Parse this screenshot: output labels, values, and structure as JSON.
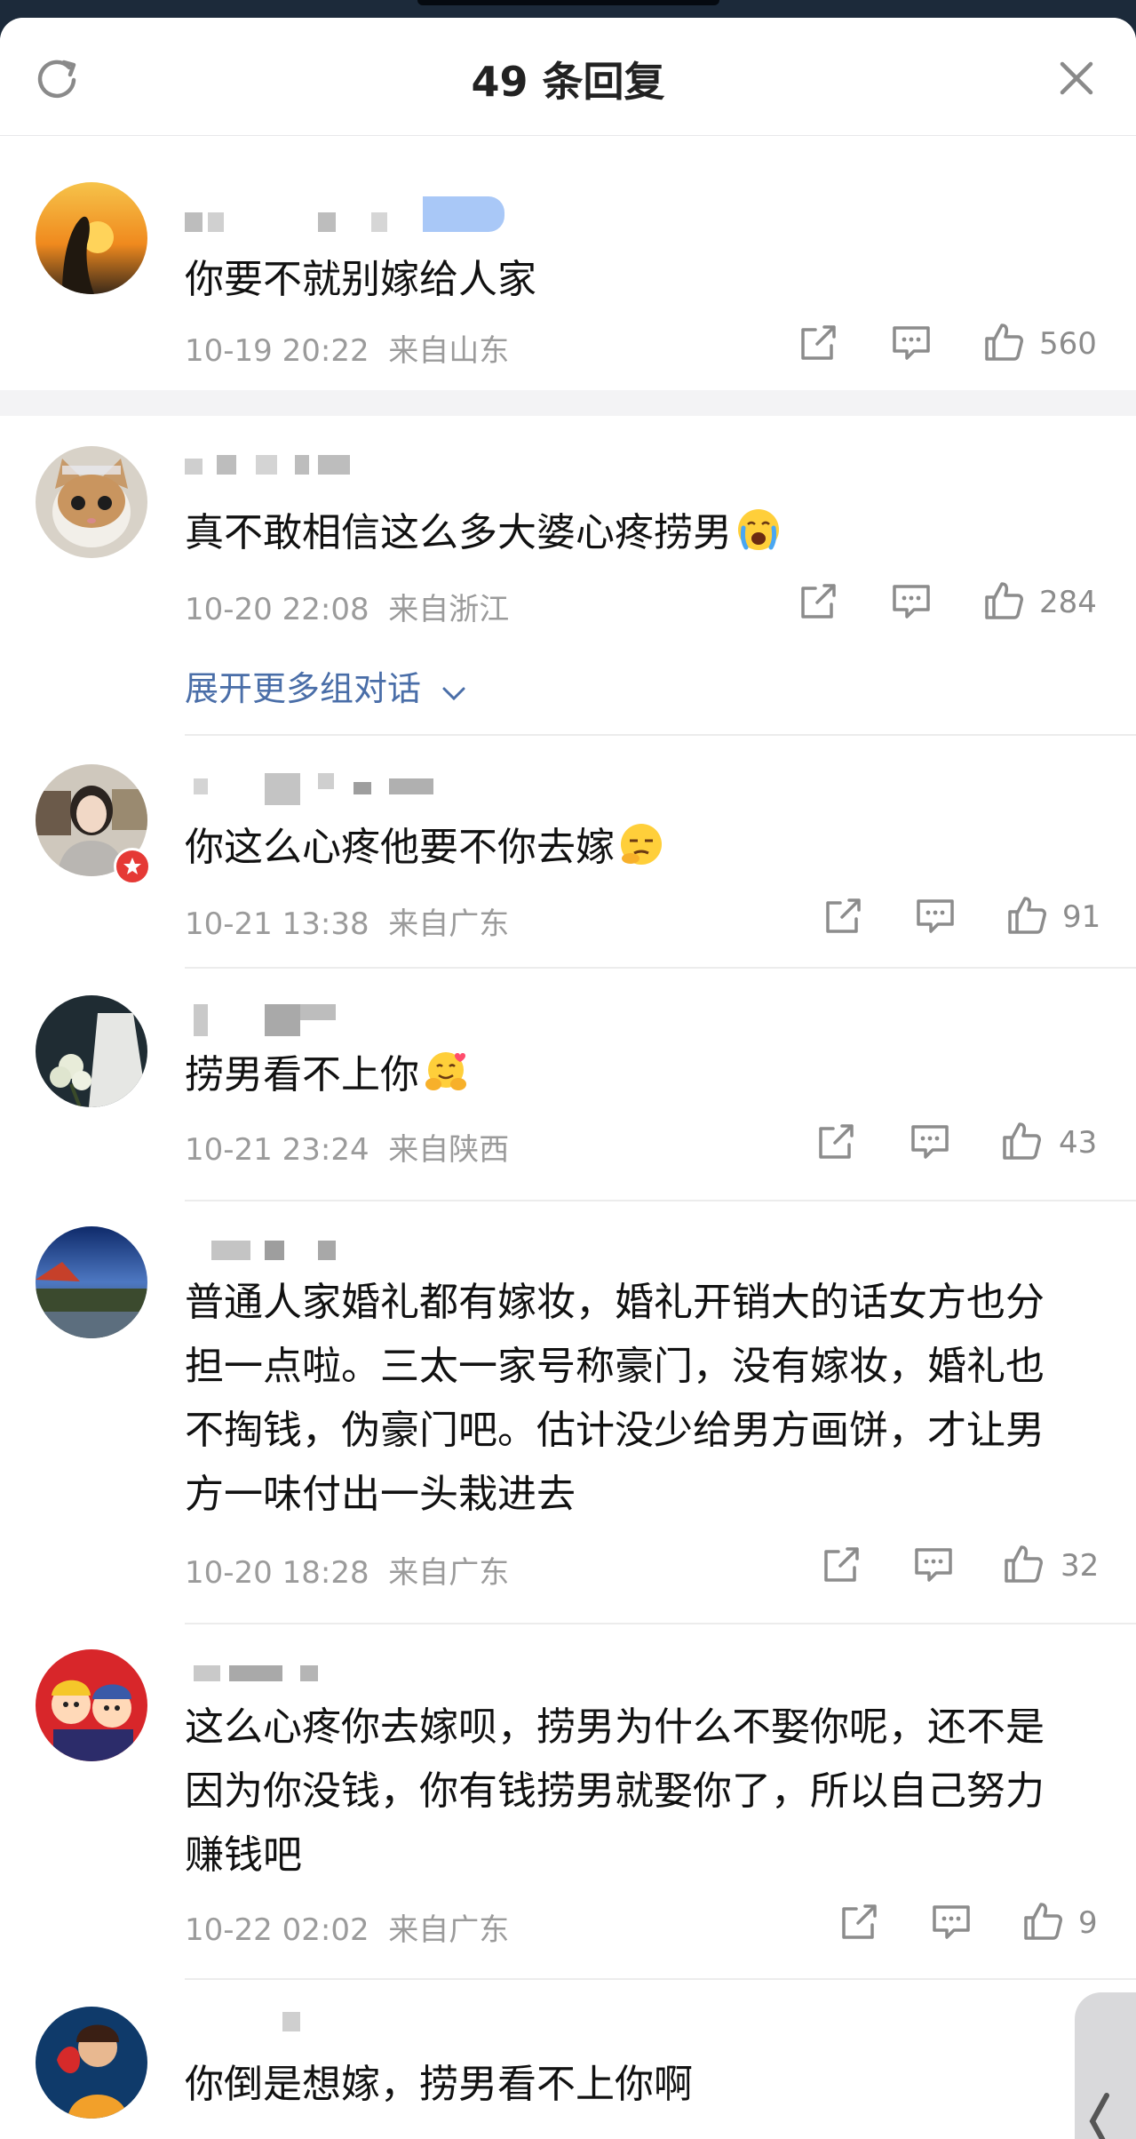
{
  "header": {
    "title": "49 条回复"
  },
  "top_comment": {
    "text": "你要不就别嫁给人家",
    "time": "10-19 20:22",
    "location": "来自山东",
    "likes": "560"
  },
  "comments": [
    {
      "text": "真不敢相信这么多大婆心疼捞男",
      "time": "10-20 22:08",
      "location": "来自浙江",
      "likes": "284",
      "expand": "展开更多组对话"
    },
    {
      "text": "你这么心疼他要不你去嫁",
      "time": "10-21 13:38",
      "location": "来自广东",
      "likes": "91"
    },
    {
      "text": "捞男看不上你",
      "time": "10-21 23:24",
      "location": "来自陕西",
      "likes": "43"
    },
    {
      "text": "普通人家婚礼都有嫁妆，婚礼开销大的话女方也分担一点啦。三太一家号称豪门，没有嫁妆，婚礼也不掏钱，伪豪门吧。估计没少给男方画饼，才让男方一味付出一头栽进去",
      "time": "10-20 18:28",
      "location": "来自广东",
      "likes": "32"
    },
    {
      "text": "这么心疼你去嫁呗，捞男为什么不娶你呢，还不是因为你没钱，你有钱捞男就娶你了，所以自己努力赚钱吧",
      "time": "10-22 02:02",
      "location": "来自广东",
      "likes": "9"
    },
    {
      "text": "你倒是想嫁，捞男看不上你啊"
    }
  ],
  "icons": {
    "refresh": "refresh-icon",
    "close": "close-icon",
    "share": "share-icon",
    "reply": "comment-icon",
    "like": "thumbs-up-icon",
    "expand": "chevron-down-icon"
  },
  "colors": {
    "link": "#4a6ea8",
    "meta": "#9b9b9b",
    "badge": "#e53935"
  }
}
